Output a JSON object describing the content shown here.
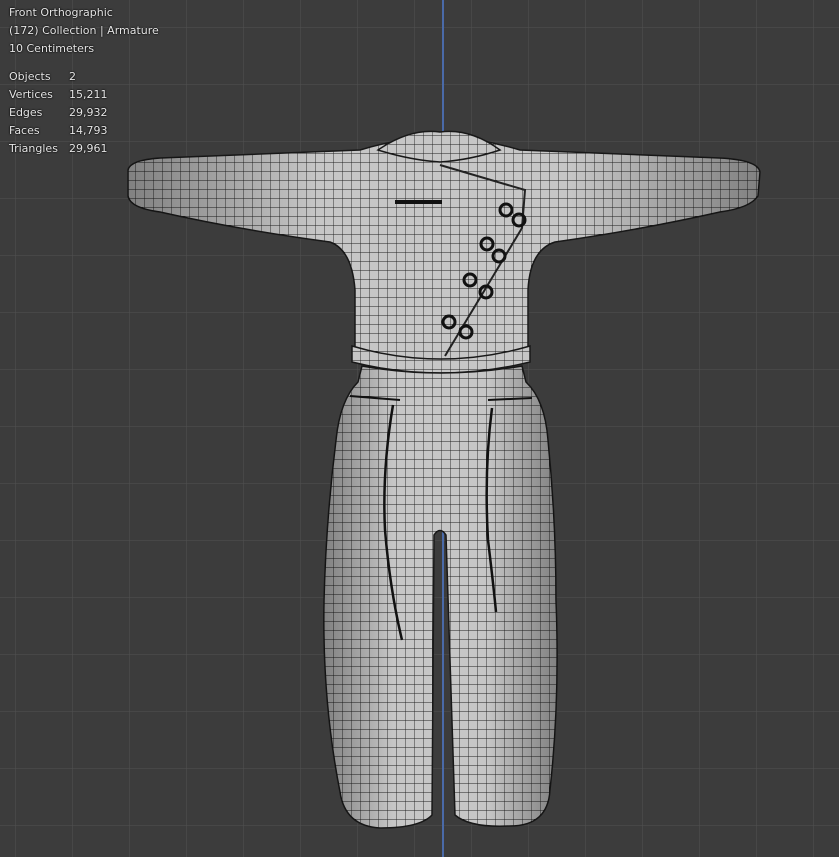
{
  "viewport": {
    "view_name": "Front Orthographic",
    "collection": "(172) Collection | Armature",
    "scale": "10 Centimeters"
  },
  "stats": [
    {
      "label": "Objects",
      "value": "2"
    },
    {
      "label": "Vertices",
      "value": "15,211"
    },
    {
      "label": "Edges",
      "value": "29,932"
    },
    {
      "label": "Faces",
      "value": "14,793"
    },
    {
      "label": "Triangles",
      "value": "29,961"
    }
  ],
  "colors": {
    "background": "#3c3c3c",
    "grid": "#505050",
    "z_axis": "#4a6aa8",
    "mesh_fill": "#c4c4c4",
    "wire": "#1e1e1e"
  }
}
